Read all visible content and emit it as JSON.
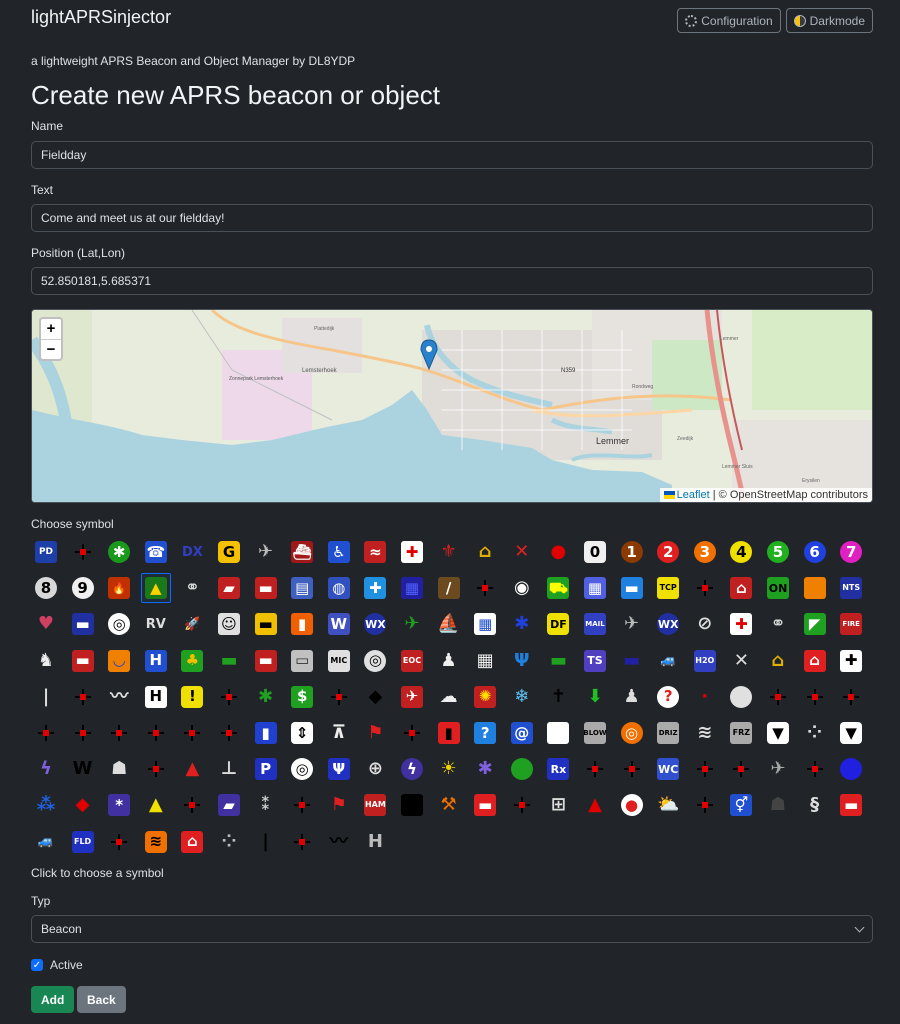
{
  "app": {
    "brand": "lightAPRSinjector",
    "subtitle": "a lightweight APRS Beacon and Object Manager by DL8YDP",
    "config_label": "Configuration",
    "darkmode_label": "Darkmode"
  },
  "form": {
    "heading": "Create new APRS beacon or object",
    "name_label": "Name",
    "name_value": "Fieldday",
    "text_label": "Text",
    "text_value": "Come and meet us at our fieldday!",
    "position_label": "Position (Lat,Lon)",
    "position_value": "52.850181,5.685371",
    "symbol_label": "Choose symbol",
    "symbol_hint": "Click to choose a symbol",
    "type_label": "Typ",
    "type_value": "Beacon",
    "active_label": "Active",
    "add_label": "Add",
    "back_label": "Back"
  },
  "map": {
    "zoom_in": "+",
    "zoom_out": "−",
    "attribution_leaflet": "Leaflet",
    "attribution_rest": "© OpenStreetMap contributors",
    "labels": [
      {
        "text": "Lemmer"
      },
      {
        "text": "N359"
      },
      {
        "text": "Lemsterhoek"
      },
      {
        "text": "Zonnepark Lemsterhoek"
      },
      {
        "text": "Plattedijk"
      },
      {
        "text": "Rondweg"
      },
      {
        "text": "Zeedijk"
      },
      {
        "text": "Lemmer"
      },
      {
        "text": "Lemmer Sluis"
      },
      {
        "text": "Erysilen"
      }
    ]
  },
  "symbols": [
    {
      "n": "police-station",
      "c": "#1e3ea8",
      "k": "tb",
      "t": "PD",
      "tc": "#fff"
    },
    {
      "n": "no-symbol-1",
      "k": "x"
    },
    {
      "n": "digi-star",
      "c": "#1a9a1a",
      "k": "g",
      "t": "✱",
      "tc": "#fff"
    },
    {
      "n": "phone",
      "c": "#2050d0",
      "k": "b",
      "t": "☎",
      "tc": "#fff"
    },
    {
      "n": "dx-cluster",
      "k": "t",
      "t": "DX",
      "tc": "#3040c0"
    },
    {
      "n": "hf-gateway",
      "c": "#f5c000",
      "k": "d",
      "t": "G",
      "tc": "#000"
    },
    {
      "n": "small-aircraft",
      "k": "t",
      "t": "✈",
      "tc": "#bbb"
    },
    {
      "n": "mobile-satellite",
      "c": "#a01818",
      "k": "b",
      "t": "⛴",
      "tc": "#fff"
    },
    {
      "n": "wheelchair",
      "c": "#2050d0",
      "k": "b",
      "t": "♿",
      "tc": "#fff"
    },
    {
      "n": "snowmobile",
      "c": "#c02020",
      "k": "b",
      "t": "≈",
      "tc": "#fff"
    },
    {
      "n": "red-cross",
      "c": "#ffffff",
      "k": "b",
      "t": "✚",
      "tc": "#e00000"
    },
    {
      "n": "boy-scouts",
      "k": "t",
      "t": "⚜",
      "tc": "#d02020"
    },
    {
      "n": "home",
      "k": "t",
      "t": "⌂",
      "tc": "#e0b000"
    },
    {
      "n": "x-mark",
      "k": "t",
      "t": "✕",
      "tc": "#e02020"
    },
    {
      "n": "red-dot",
      "k": "t",
      "t": "●",
      "tc": "#e00000"
    },
    {
      "n": "circle-0",
      "c": "#f0f0f0",
      "k": "d",
      "t": "0",
      "tc": "#000"
    },
    {
      "n": "circle-1",
      "c": "#8b3a00",
      "k": "o",
      "t": "1",
      "tc": "#fff"
    },
    {
      "n": "circle-2",
      "c": "#e02020",
      "k": "o",
      "t": "2",
      "tc": "#fff"
    },
    {
      "n": "circle-3",
      "c": "#f07000",
      "k": "o",
      "t": "3",
      "tc": "#fff"
    },
    {
      "n": "circle-4",
      "c": "#f0e000",
      "k": "o",
      "t": "4",
      "tc": "#000"
    },
    {
      "n": "circle-5",
      "c": "#20b020",
      "k": "o",
      "t": "5",
      "tc": "#fff"
    },
    {
      "n": "circle-6",
      "c": "#2040e0",
      "k": "o",
      "t": "6",
      "tc": "#fff"
    },
    {
      "n": "circle-7",
      "c": "#e020c0",
      "k": "o",
      "t": "7",
      "tc": "#fff"
    },
    {
      "n": "circle-8",
      "c": "#d8d8d8",
      "k": "o",
      "t": "8",
      "tc": "#000"
    },
    {
      "n": "circle-9",
      "c": "#f0f0f0",
      "k": "o",
      "t": "9",
      "tc": "#000"
    },
    {
      "n": "fire",
      "c": "#c03000",
      "k": "b",
      "t": "🔥",
      "tc": "#ff0"
    },
    {
      "n": "campground",
      "c": "#1a7a1a",
      "k": "b",
      "t": "▲",
      "tc": "#ffd000"
    },
    {
      "n": "motorcycle",
      "k": "t",
      "t": "⚭",
      "tc": "#ddd"
    },
    {
      "n": "railroad-engine",
      "c": "#c02020",
      "k": "b",
      "t": "▰",
      "tc": "#fff"
    },
    {
      "n": "car",
      "c": "#c02020",
      "k": "b",
      "t": "▬",
      "tc": "#fff"
    },
    {
      "n": "file-server",
      "c": "#4060c0",
      "k": "b",
      "t": "▤",
      "tc": "#fff"
    },
    {
      "n": "hurricane-future",
      "c": "#3050c0",
      "k": "b",
      "t": "◍",
      "tc": "#fff"
    },
    {
      "n": "aid-station",
      "c": "#2090e0",
      "k": "b",
      "t": "✚",
      "tc": "#fff"
    },
    {
      "n": "bbs",
      "c": "#2020a0",
      "k": "b",
      "t": "▦",
      "tc": "#5060ff"
    },
    {
      "n": "canoe",
      "c": "#6b4a20",
      "k": "b",
      "t": "/",
      "tc": "#fff"
    },
    {
      "n": "no-symbol-2",
      "k": "x"
    },
    {
      "n": "eyeball",
      "k": "t",
      "t": "◉",
      "tc": "#fff"
    },
    {
      "n": "tractor",
      "c": "#20a020",
      "k": "b",
      "t": "⛟",
      "tc": "#ff0"
    },
    {
      "n": "grid-square",
      "c": "#5060e0",
      "k": "b",
      "t": "▦",
      "tc": "#fff"
    },
    {
      "n": "hotel",
      "c": "#2080e0",
      "k": "b",
      "t": "▬",
      "tc": "#fff"
    },
    {
      "n": "tcp-ip",
      "c": "#f0e000",
      "k": "b",
      "t": "TCP",
      "tc": "#000"
    },
    {
      "n": "no-symbol-3",
      "k": "x"
    },
    {
      "n": "school",
      "c": "#c02020",
      "k": "b",
      "t": "⌂",
      "tc": "#fff"
    },
    {
      "n": "pc-user",
      "c": "#20a020",
      "k": "b",
      "t": "ON",
      "tc": "#000"
    },
    {
      "n": "mac-apple",
      "c": "#f08000",
      "k": "b",
      "t": "",
      "tc": "#fff"
    },
    {
      "n": "nts-station",
      "c": "#2030a0",
      "k": "b",
      "t": "NTS",
      "tc": "#fff"
    },
    {
      "n": "balloon",
      "k": "t",
      "t": "♥",
      "tc": "#d04060"
    },
    {
      "n": "police-car",
      "c": "#2030a0",
      "k": "b",
      "t": "▬",
      "tc": "#fff"
    },
    {
      "n": "target",
      "c": "#ffffff",
      "k": "o",
      "t": "◎",
      "tc": "#000"
    },
    {
      "n": "rv",
      "k": "t",
      "t": "RV",
      "tc": "#ddd"
    },
    {
      "n": "shuttle",
      "k": "t",
      "t": "🚀",
      "tc": "#ddd"
    },
    {
      "n": "sstv",
      "c": "#e0e0e0",
      "k": "b",
      "t": "☺",
      "tc": "#000"
    },
    {
      "n": "bus",
      "c": "#f0c000",
      "k": "b",
      "t": "▬",
      "tc": "#000"
    },
    {
      "n": "atv",
      "c": "#f06000",
      "k": "b",
      "t": "▮",
      "tc": "#fff"
    },
    {
      "n": "nws-site",
      "c": "#4050c0",
      "k": "b",
      "t": "W",
      "tc": "#fff"
    },
    {
      "n": "wx-station",
      "c": "#2030a0",
      "k": "o",
      "t": "WX",
      "tc": "#fff"
    },
    {
      "n": "helicopter",
      "k": "t",
      "t": "✈",
      "tc": "#20a020"
    },
    {
      "n": "sailboat",
      "k": "t",
      "t": "⛵",
      "tc": "#eee"
    },
    {
      "n": "windows-logo",
      "c": "#ffffff",
      "k": "b",
      "t": "▦",
      "tc": "#2050d0"
    },
    {
      "n": "human",
      "k": "t",
      "t": "✱",
      "tc": "#2040e0"
    },
    {
      "n": "df-station",
      "c": "#f0e000",
      "k": "d",
      "t": "DF",
      "tc": "#000"
    },
    {
      "n": "mail-postoffice",
      "c": "#3040c0",
      "k": "b",
      "t": "MAIL",
      "tc": "#fff"
    },
    {
      "n": "large-aircraft",
      "k": "t",
      "t": "✈",
      "tc": "#bbb"
    },
    {
      "n": "weather-station",
      "c": "#2030a0",
      "k": "o",
      "t": "WX",
      "tc": "#fff"
    },
    {
      "n": "dish-antenna",
      "k": "t",
      "t": "⊘",
      "tc": "#ddd"
    },
    {
      "n": "ambulance",
      "c": "#ffffff",
      "k": "b",
      "t": "✚",
      "tc": "#e00000"
    },
    {
      "n": "bicycle",
      "k": "t",
      "t": "⚭",
      "tc": "#ddd"
    },
    {
      "n": "incident-command",
      "c": "#20a020",
      "k": "b",
      "t": "◤",
      "tc": "#fff"
    },
    {
      "n": "fire-department",
      "c": "#c02020",
      "k": "b",
      "t": "FIRE",
      "tc": "#fff"
    },
    {
      "n": "horse",
      "k": "t",
      "t": "♞",
      "tc": "#eee"
    },
    {
      "n": "fire-truck",
      "c": "#c02020",
      "k": "b",
      "t": "▬",
      "tc": "#fff"
    },
    {
      "n": "glider",
      "c": "#f08000",
      "k": "b",
      "t": "◡",
      "tc": "#2040d0"
    },
    {
      "n": "hospital",
      "c": "#2050d0",
      "k": "b",
      "t": "H",
      "tc": "#fff"
    },
    {
      "n": "island",
      "c": "#20a020",
      "k": "b",
      "t": "♣",
      "tc": "#f0c000"
    },
    {
      "n": "jeep",
      "k": "t",
      "t": "▬",
      "tc": "#20a020"
    },
    {
      "n": "truck",
      "c": "#c02020",
      "k": "b",
      "t": "▬",
      "tc": "#fff"
    },
    {
      "n": "laptop",
      "c": "#c0c0c0",
      "k": "b",
      "t": "▭",
      "tc": "#333"
    },
    {
      "n": "mic-e-repeater",
      "c": "#e0e0e0",
      "k": "b",
      "t": "MIC",
      "tc": "#000"
    },
    {
      "n": "node",
      "c": "#e0e0e0",
      "k": "o",
      "t": "◎",
      "tc": "#000"
    },
    {
      "n": "eoc",
      "c": "#c02020",
      "k": "b",
      "t": "EOC",
      "tc": "#fff"
    },
    {
      "n": "rover-dog",
      "k": "t",
      "t": "♟",
      "tc": "#eee"
    },
    {
      "n": "grid-square-2",
      "k": "t",
      "t": "▦",
      "tc": "#eee"
    },
    {
      "n": "repeater-antenna",
      "k": "t",
      "t": "Ψ",
      "tc": "#2080e0"
    },
    {
      "n": "ship",
      "k": "t",
      "t": "▬",
      "tc": "#20a020"
    },
    {
      "n": "truck-stop",
      "c": "#5040c0",
      "k": "b",
      "t": "TS",
      "tc": "#fff"
    },
    {
      "n": "semi-truck",
      "k": "t",
      "t": "▬",
      "tc": "#2020a0"
    },
    {
      "n": "van",
      "k": "t",
      "t": "🚙",
      "tc": "#60a0e0"
    },
    {
      "n": "water-station",
      "c": "#3040c0",
      "k": "b",
      "t": "H2O",
      "tc": "#fff"
    },
    {
      "n": "x-aprs",
      "k": "t",
      "t": "✕",
      "tc": "#ddd"
    },
    {
      "n": "house-qth",
      "k": "t",
      "t": "⌂",
      "tc": "#e0b000"
    },
    {
      "n": "red-house",
      "c": "#e02020",
      "k": "b",
      "t": "⌂",
      "tc": "#fff"
    },
    {
      "n": "church",
      "c": "#ffffff",
      "k": "b",
      "t": "✚",
      "tc": "#000"
    },
    {
      "n": "vertical-bar",
      "k": "t",
      "t": "|",
      "tc": "#ddd"
    },
    {
      "n": "no-symbol-4",
      "k": "x"
    },
    {
      "n": "squiggle",
      "k": "t",
      "t": "〰",
      "tc": "#ddd"
    },
    {
      "n": "rev-h",
      "c": "#ffffff",
      "k": "b",
      "t": "H",
      "tc": "#000"
    },
    {
      "n": "caution-sign",
      "c": "#f0e000",
      "k": "d",
      "t": "!",
      "tc": "#000"
    },
    {
      "n": "no-symbol-5",
      "k": "x"
    },
    {
      "n": "green-star",
      "k": "t",
      "t": "✱",
      "tc": "#20a020"
    },
    {
      "n": "dollar-bank",
      "c": "#20a020",
      "k": "b",
      "t": "$",
      "tc": "#fff"
    },
    {
      "n": "no-symbol-6",
      "k": "x"
    },
    {
      "n": "black-diamond",
      "k": "t",
      "t": "◆",
      "tc": "#000"
    },
    {
      "n": "crash-site",
      "c": "#c02020",
      "k": "b",
      "t": "✈",
      "tc": "#fff"
    },
    {
      "n": "cloudy",
      "k": "t",
      "t": "☁",
      "tc": "#eee"
    },
    {
      "n": "fire-red",
      "c": "#c02020",
      "k": "b",
      "t": "✺",
      "tc": "#ffe000"
    },
    {
      "n": "snowflake",
      "k": "t",
      "t": "❄",
      "tc": "#60c0f0"
    },
    {
      "n": "church-cross",
      "k": "t",
      "t": "✝",
      "tc": "#000"
    },
    {
      "n": "green-arrow",
      "k": "t",
      "t": "⬇",
      "tc": "#20c020"
    },
    {
      "n": "cable-car",
      "k": "t",
      "t": "♟",
      "tc": "#ddd"
    },
    {
      "n": "help-question",
      "c": "#ffffff",
      "k": "o",
      "t": "?",
      "tc": "#e02020"
    },
    {
      "n": "small-red-dot",
      "k": "t",
      "t": "·",
      "tc": "#e00000"
    },
    {
      "n": "white-circle",
      "c": "#e0e0e0",
      "k": "o",
      "t": "",
      "tc": "#000"
    },
    {
      "n": "no-symbol-7",
      "k": "x"
    },
    {
      "n": "no-symbol-8",
      "k": "x"
    },
    {
      "n": "no-symbol-9",
      "k": "x"
    },
    {
      "n": "no-symbol-10",
      "k": "x"
    },
    {
      "n": "no-symbol-11",
      "k": "x"
    },
    {
      "n": "no-symbol-12",
      "k": "x"
    },
    {
      "n": "no-symbol-13",
      "k": "x"
    },
    {
      "n": "no-symbol-14",
      "k": "x"
    },
    {
      "n": "no-symbol-15",
      "k": "x"
    },
    {
      "n": "gas-station",
      "c": "#2040d0",
      "k": "b",
      "t": "▮",
      "tc": "#fff"
    },
    {
      "n": "updown-arrow",
      "c": "#ffffff",
      "k": "d",
      "t": "⇕",
      "tc": "#000"
    },
    {
      "n": "picnic-table",
      "k": "t",
      "t": "⊼",
      "tc": "#eee"
    },
    {
      "n": "red-flag",
      "k": "t",
      "t": "⚑",
      "tc": "#e02020"
    },
    {
      "n": "no-symbol-16",
      "k": "x"
    },
    {
      "n": "fire-hydrant",
      "c": "#e02020",
      "k": "b",
      "t": "▮",
      "tc": "#000"
    },
    {
      "n": "info-kiosk",
      "c": "#2080e0",
      "k": "b",
      "t": "?",
      "tc": "#fff"
    },
    {
      "n": "hurricane",
      "c": "#2050d0",
      "k": "b",
      "t": "@",
      "tc": "#fff"
    },
    {
      "n": "white-box",
      "c": "#ffffff",
      "k": "b",
      "t": "",
      "tc": "#000"
    },
    {
      "n": "blowing-snow",
      "c": "#aaaaaa",
      "k": "b",
      "t": "BLOW",
      "tc": "#000"
    },
    {
      "n": "coast-guard",
      "c": "#f07000",
      "k": "o",
      "t": "◎",
      "tc": "#fff"
    },
    {
      "n": "drizzle",
      "c": "#aaaaaa",
      "k": "b",
      "t": "DRIZ",
      "tc": "#000"
    },
    {
      "n": "smoke",
      "k": "t",
      "t": "≋",
      "tc": "#ddd"
    },
    {
      "n": "freezing-rain",
      "c": "#aaaaaa",
      "k": "b",
      "t": "FRZ",
      "tc": "#000"
    },
    {
      "n": "snow-shower",
      "c": "#ffffff",
      "k": "d",
      "t": "▼",
      "tc": "#000"
    },
    {
      "n": "hail",
      "k": "t",
      "t": "⁘",
      "tc": "#ddd"
    },
    {
      "n": "rain-shower",
      "c": "#ffffff",
      "k": "d",
      "t": "▼",
      "tc": "#000"
    },
    {
      "n": "lightning",
      "k": "t",
      "t": "ϟ",
      "tc": "#8060e0"
    },
    {
      "n": "storm-w",
      "k": "t",
      "t": "W",
      "tc": "#000"
    },
    {
      "n": "lighthouse",
      "k": "t",
      "t": "☗",
      "tc": "#ddd"
    },
    {
      "n": "no-symbol-17",
      "k": "x"
    },
    {
      "n": "navigation-buoy",
      "k": "t",
      "t": "▲",
      "tc": "#e02020"
    },
    {
      "n": "rocket-launch",
      "k": "t",
      "t": "⊥",
      "tc": "#ddd"
    },
    {
      "n": "parking",
      "c": "#2030c0",
      "k": "b",
      "t": "P",
      "tc": "#fff"
    },
    {
      "n": "quake",
      "c": "#ffffff",
      "k": "o",
      "t": "◎",
      "tc": "#000"
    },
    {
      "n": "restaurant",
      "c": "#2030c0",
      "k": "b",
      "t": "Ψ",
      "tc": "#fff"
    },
    {
      "n": "satellite-pacsat",
      "k": "t",
      "t": "⊕",
      "tc": "#ddd"
    },
    {
      "n": "thunderstorm",
      "c": "#4030a0",
      "k": "o",
      "t": "ϟ",
      "tc": "#fff"
    },
    {
      "n": "sunny",
      "k": "t",
      "t": "☀",
      "tc": "#f0d000"
    },
    {
      "n": "vortac",
      "k": "t",
      "t": "✱",
      "tc": "#8060e0"
    },
    {
      "n": "nws-green",
      "c": "#20a020",
      "k": "o",
      "t": "",
      "tc": "#fff"
    },
    {
      "n": "pharmacy-rx",
      "c": "#2030c0",
      "k": "b",
      "t": "Rx",
      "tc": "#fff"
    },
    {
      "n": "no-symbol-18",
      "k": "x"
    },
    {
      "n": "no-symbol-19",
      "k": "x"
    },
    {
      "n": "wall-cloud",
      "c": "#3050d0",
      "k": "b",
      "t": "WC",
      "tc": "#fff"
    },
    {
      "n": "no-symbol-20",
      "k": "x"
    },
    {
      "n": "no-symbol-21",
      "k": "x"
    },
    {
      "n": "aircraft-grey",
      "k": "t",
      "t": "✈",
      "tc": "#aaa"
    },
    {
      "n": "no-symbol-22",
      "k": "x"
    },
    {
      "n": "blue-circle",
      "c": "#2020e0",
      "k": "o",
      "t": "",
      "tc": "#fff"
    },
    {
      "n": "rain",
      "k": "t",
      "t": "⁂",
      "tc": "#2060e0"
    },
    {
      "n": "red-diamond",
      "k": "t",
      "t": "◆",
      "tc": "#e00000"
    },
    {
      "n": "snow",
      "c": "#4030a0",
      "k": "b",
      "t": "*",
      "tc": "#fff"
    },
    {
      "n": "yellow-triangle",
      "k": "t",
      "t": "▲",
      "tc": "#f0e000"
    },
    {
      "n": "no-symbol-23",
      "k": "x"
    },
    {
      "n": "train-station",
      "c": "#4030a0",
      "k": "b",
      "t": "▰",
      "tc": "#fff"
    },
    {
      "n": "tornado-grey",
      "k": "t",
      "t": "⁑",
      "tc": "#ccc"
    },
    {
      "n": "no-symbol-24",
      "k": "x"
    },
    {
      "n": "red-flag-2",
      "k": "t",
      "t": "⚑",
      "tc": "#e02020"
    },
    {
      "n": "ham-store",
      "c": "#c02020",
      "k": "b",
      "t": "HAM",
      "tc": "#fff"
    },
    {
      "n": "black-box",
      "c": "#000000",
      "k": "b",
      "t": "",
      "tc": "#fff"
    },
    {
      "n": "work-zone",
      "k": "t",
      "t": "⚒",
      "tc": "#f07000"
    },
    {
      "n": "red-van",
      "c": "#e02020",
      "k": "b",
      "t": "▬",
      "tc": "#fff"
    },
    {
      "n": "no-symbol-25",
      "k": "x"
    },
    {
      "n": "area-locations",
      "k": "t",
      "t": "⊞",
      "tc": "#ddd"
    },
    {
      "n": "red-triangle",
      "k": "t",
      "t": "▲",
      "tc": "#e00000"
    },
    {
      "n": "small-circle",
      "c": "#ffffff",
      "k": "o",
      "t": "●",
      "tc": "#e02020"
    },
    {
      "n": "partly-cloudy",
      "k": "t",
      "t": "⛅",
      "tc": "#f0d000"
    },
    {
      "n": "no-symbol-26",
      "k": "x"
    },
    {
      "n": "restrooms",
      "c": "#2050d0",
      "k": "b",
      "t": "⚥",
      "tc": "#fff"
    },
    {
      "n": "grey-shape",
      "k": "t",
      "t": "☗",
      "tc": "#444"
    },
    {
      "n": "tornado",
      "k": "t",
      "t": "§",
      "tc": "#ddd"
    },
    {
      "n": "red-truck",
      "c": "#e02020",
      "k": "b",
      "t": "▬",
      "tc": "#fff"
    },
    {
      "n": "blue-car",
      "k": "t",
      "t": "🚙",
      "tc": "#60a0e0"
    },
    {
      "n": "flooding",
      "c": "#2030c0",
      "k": "b",
      "t": "FLD",
      "tc": "#fff"
    },
    {
      "n": "no-symbol-27",
      "k": "x"
    },
    {
      "n": "smoke-orange",
      "c": "#f07000",
      "k": "d",
      "t": "≋",
      "tc": "#000"
    },
    {
      "n": "red-house-2",
      "c": "#e02020",
      "k": "b",
      "t": "⌂",
      "tc": "#fff"
    },
    {
      "n": "fog",
      "k": "t",
      "t": "⁘",
      "tc": "#bbb"
    },
    {
      "n": "black-bar",
      "k": "t",
      "t": "|",
      "tc": "#000"
    },
    {
      "n": "no-symbol-28",
      "k": "x"
    },
    {
      "n": "squiggle-2",
      "k": "t",
      "t": "〰",
      "tc": "#000"
    },
    {
      "n": "rev-h-2",
      "k": "t",
      "t": "H",
      "tc": "#bbb"
    }
  ],
  "selected_symbol_index": 26
}
